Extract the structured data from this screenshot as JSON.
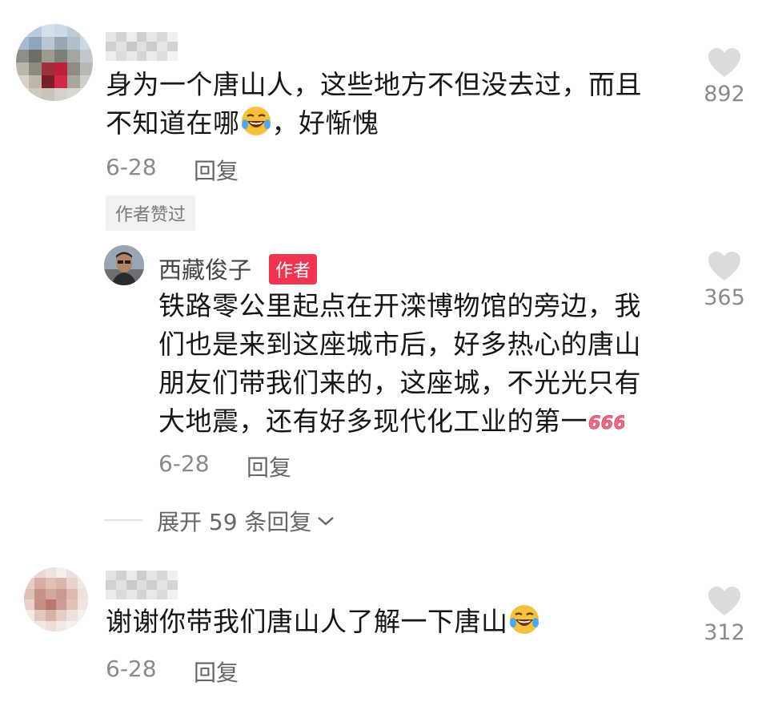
{
  "comments": [
    {
      "text_part1": "身为一个唐山人，这些地方不但没去过，而且",
      "text_part2": "不知道在哪",
      "text_part3": "，好惭愧",
      "date": "6-28",
      "reply_label": "回复",
      "likes": "892",
      "liked_by_author": "作者赞过"
    },
    {
      "text": "谢谢你带我们唐山人了解一下唐山",
      "date": "6-28",
      "reply_label": "回复",
      "likes": "312"
    }
  ],
  "author_reply": {
    "name": "西藏俊子",
    "badge": "作者",
    "line1": "铁路零公里起点在开滦博物馆的旁边，我",
    "line2": "们也是来到这座城市后，好多热心的唐山",
    "line3": "朋友们带我们来的，这座城，不光光只有",
    "line4": "大地震，还有好多现代化工业的第一",
    "badge_666": "666",
    "date": "6-28",
    "reply_label": "回复",
    "likes": "365"
  },
  "expand_replies": {
    "label": "展开 59 条回复"
  },
  "icons": {
    "like": "heart-icon",
    "emoji": "laughing-tears-emoji-icon",
    "expand": "chevron-down-icon"
  },
  "colors": {
    "author_badge": "#f0334f",
    "like_heart": "#dcdcdc",
    "meta_text": "#8a8a8a"
  }
}
